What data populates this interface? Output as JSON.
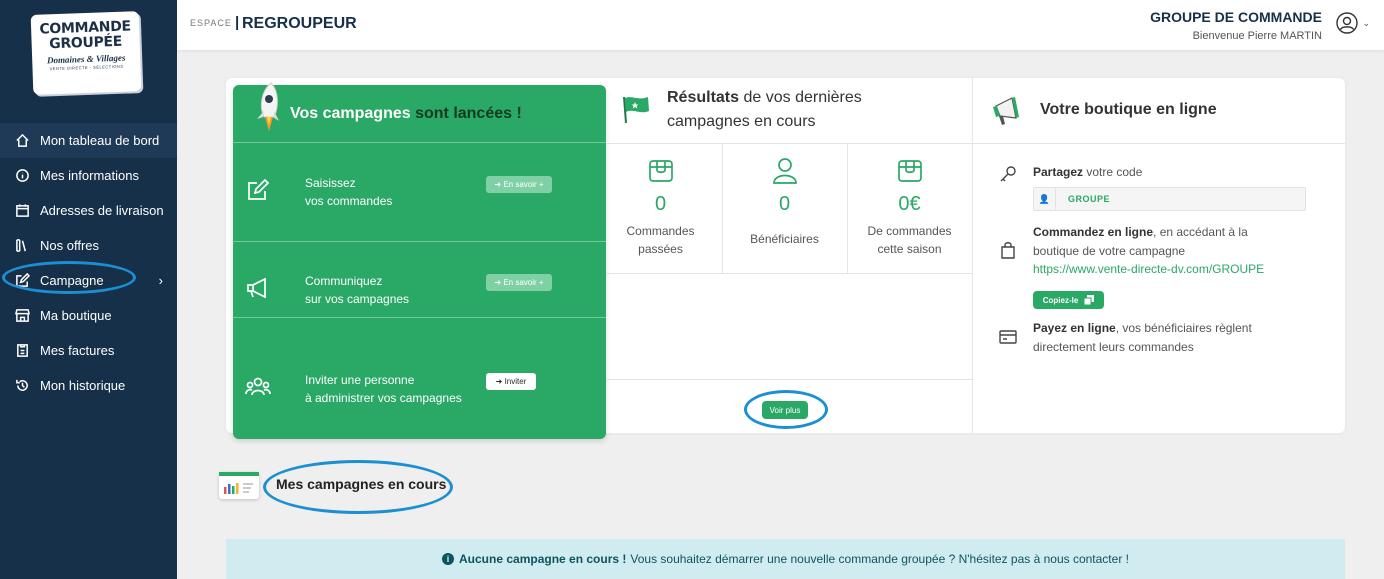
{
  "logo": {
    "line1": "COMMANDE",
    "line2": "GROUPÉE",
    "sub": "Domaines & Villages",
    "tag": "VENTE DIRECTE · SÉLECTIONS"
  },
  "sidebar": {
    "items": [
      {
        "label": "Mon tableau de bord",
        "icon": "home-icon"
      },
      {
        "label": "Mes informations",
        "icon": "info-icon"
      },
      {
        "label": "Adresses de livraison",
        "icon": "calendar-icon"
      },
      {
        "label": "Nos offres",
        "icon": "books-icon"
      },
      {
        "label": "Campagne",
        "icon": "edit-icon"
      },
      {
        "label": "Ma boutique",
        "icon": "store-icon"
      },
      {
        "label": "Mes factures",
        "icon": "invoice-icon"
      },
      {
        "label": "Mon historique",
        "icon": "history-icon"
      }
    ]
  },
  "header": {
    "espace": "ESPACE",
    "separator": "|",
    "section": "REGROUPEUR",
    "group_name": "GROUPE DE COMMANDE",
    "welcome": "Bienvenue Pierre MARTIN"
  },
  "campaigns_panel": {
    "title_light": "Vos campagnes",
    "title_dark": "sont lancées !",
    "rows": [
      {
        "line1": "Saisissez",
        "line2": "vos commandes",
        "button": "➜ En savoir +",
        "icon": "edit-square-icon"
      },
      {
        "line1": "Communiquez",
        "line2": "sur vos campagnes",
        "button": "➜ En savoir +",
        "icon": "megaphone-icon"
      },
      {
        "line1": "Inviter une personne",
        "line2": "à administrer vos campagnes",
        "button": "➜ Inviter",
        "icon": "users-icon"
      }
    ]
  },
  "results": {
    "title_bold": "Résultats",
    "title_rest": "de vos dernières campagnes en cours",
    "stats": [
      {
        "value": "0",
        "label1": "Commandes",
        "label2": "passées",
        "icon": "box-icon"
      },
      {
        "value": "0",
        "label1": "Bénéficiaires",
        "label2": "",
        "icon": "person-icon"
      },
      {
        "value": "0€",
        "label1": "De commandes",
        "label2": "cette saison",
        "icon": "box-icon"
      }
    ],
    "voir_plus": "Voir plus"
  },
  "boutique": {
    "title": "Votre boutique en ligne",
    "share_bold": "Partagez",
    "share_rest": "votre code",
    "code": "GROUPE",
    "order_bold": "Commandez en ligne",
    "order_rest": ", en accédant à la",
    "order_line2": "boutique de votre campagne",
    "link": "https://www.vente-directe-dv.com/GROUPE",
    "copy_label": "Copiez-le",
    "pay_bold": "Payez en ligne",
    "pay_rest": ", vos bénéficiaires règlent",
    "pay_line2": "directement leurs commandes"
  },
  "mes_campagnes": {
    "title": "Mes campagnes en cours"
  },
  "alert": {
    "bold": "Aucune campagne en cours !",
    "text": "Vous souhaitez démarrer une nouvelle commande groupée ? N'hésitez pas à nous contacter !"
  },
  "colors": {
    "sidebar": "#16304a",
    "green": "#2aa866",
    "highlight_oval": "#1c8fd3",
    "alert_bg": "#d1ecf1"
  }
}
